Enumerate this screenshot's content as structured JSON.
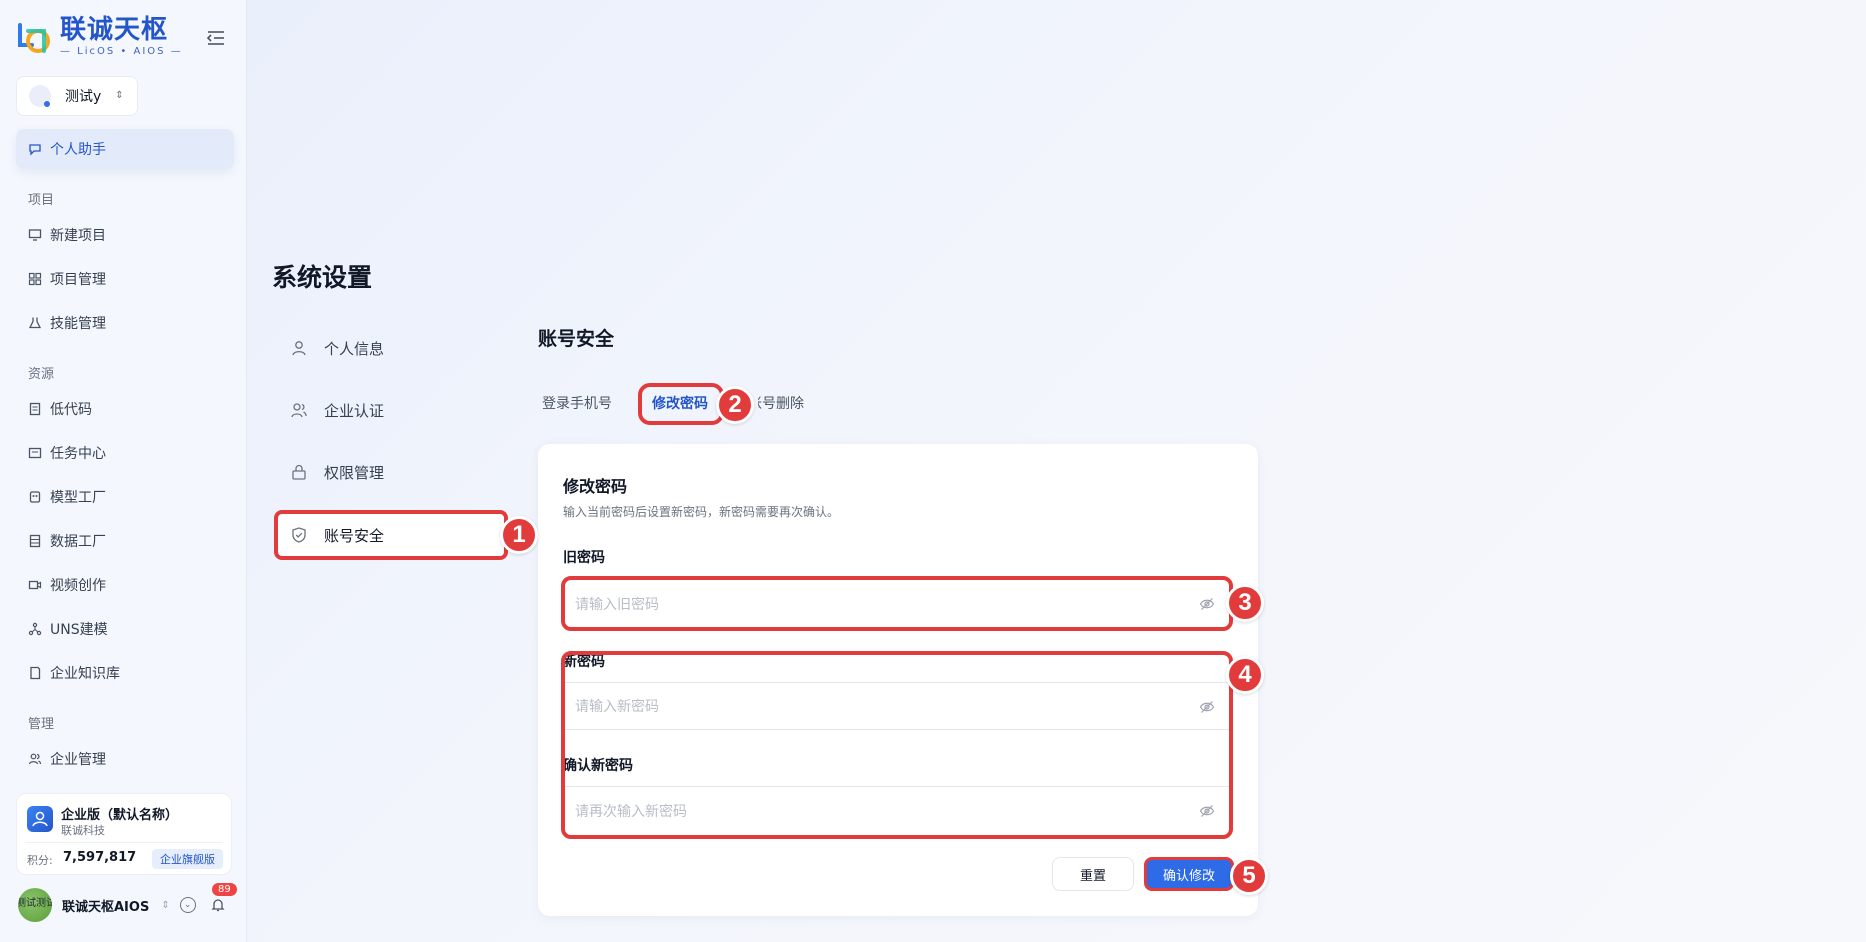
{
  "brand": {
    "title": "联诚天枢",
    "subtitle": "— LicOS • AIOS —"
  },
  "workspace": {
    "label": "测试y",
    "caret": "⇕"
  },
  "sidebar": {
    "active_item": {
      "label": "个人助手",
      "icon": "chat-icon"
    },
    "sections": [
      {
        "title": "项目",
        "items": [
          {
            "label": "新建项目",
            "icon": "monitor-icon"
          },
          {
            "label": "项目管理",
            "icon": "grid-icon"
          },
          {
            "label": "技能管理",
            "icon": "flask-icon"
          }
        ]
      },
      {
        "title": "资源",
        "items": [
          {
            "label": "低代码",
            "icon": "document-icon"
          },
          {
            "label": "任务中心",
            "icon": "task-icon"
          },
          {
            "label": "模型工厂",
            "icon": "robot-icon"
          },
          {
            "label": "数据工厂",
            "icon": "database-icon"
          },
          {
            "label": "视频创作",
            "icon": "video-icon"
          },
          {
            "label": "UNS建模",
            "icon": "network-icon"
          },
          {
            "label": "企业知识库",
            "icon": "book-icon"
          }
        ]
      },
      {
        "title": "管理",
        "items": [
          {
            "label": "企业管理",
            "icon": "users-icon"
          }
        ]
      }
    ]
  },
  "org_card": {
    "name": "企业版（默认名称）",
    "company": "联诚科技",
    "points_label": "积分:",
    "points_value": "7,597,817",
    "plan": "企业旗舰版"
  },
  "user": {
    "name": "联诚天枢AIOS",
    "avatar_text": "测试测试",
    "caret": "⇕",
    "notifications": "89"
  },
  "page": {
    "title": "系统设置"
  },
  "settings_nav": [
    {
      "label": "个人信息",
      "icon": "user-icon"
    },
    {
      "label": "企业认证",
      "icon": "users-icon"
    },
    {
      "label": "权限管理",
      "icon": "lock-icon"
    },
    {
      "label": "账号安全",
      "icon": "shield-check-icon"
    }
  ],
  "security": {
    "title": "账号安全",
    "tabs": [
      {
        "label": "登录手机号"
      },
      {
        "label": "修改密码"
      },
      {
        "label": "账号删除"
      }
    ],
    "active_tab": "修改密码"
  },
  "password_form": {
    "title": "修改密码",
    "description": "输入当前密码后设置新密码，新密码需要再次确认。",
    "old_label": "旧密码",
    "old_placeholder": "请输入旧密码",
    "new_label": "新密码",
    "new_placeholder": "请输入新密码",
    "confirm_label": "确认新密码",
    "confirm_placeholder": "请再次输入新密码",
    "reset_button": "重置",
    "confirm_button": "确认修改"
  },
  "annotations": {
    "markers": [
      "1",
      "2",
      "3",
      "4",
      "5"
    ],
    "color": "#e23b3b"
  },
  "colors": {
    "accent": "#2456c9",
    "primary_button": "#2e6be6",
    "highlight": "#e23b3b"
  }
}
